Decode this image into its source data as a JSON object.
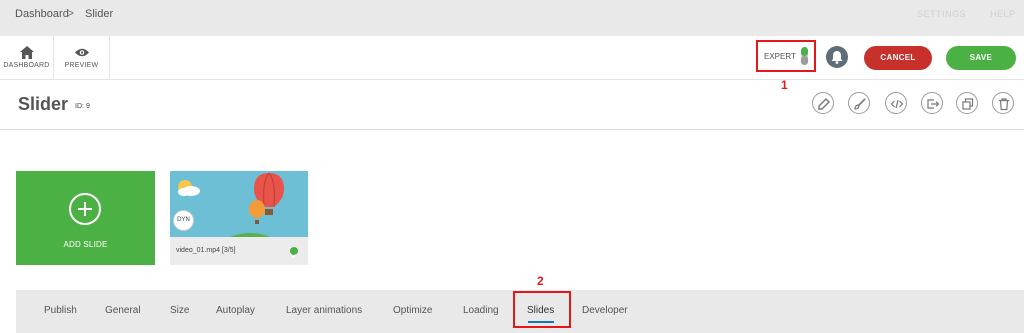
{
  "breadcrumb": {
    "items": [
      "Dashboard",
      "Slider"
    ],
    "separator": ">"
  },
  "top_links": [
    "SETTINGS",
    "HELP"
  ],
  "toolbar": {
    "dashboard_label": "DASHBOARD",
    "preview_label": "PREVIEW",
    "expert_label": "EXPERT",
    "expert_enabled": true,
    "cancel_label": "CANCEL",
    "save_label": "SAVE"
  },
  "annotations": [
    "1",
    "2"
  ],
  "header": {
    "title": "Slider",
    "id_label": "ID:",
    "id_value": "9",
    "actions": [
      "edit-icon",
      "brush-icon",
      "code-icon",
      "export-icon",
      "duplicate-icon",
      "trash-icon"
    ]
  },
  "slides": {
    "add_label": "ADD SLIDE",
    "items": [
      {
        "name": "video_01.mp4 [3/5]",
        "badge": "DYN",
        "published": true
      }
    ]
  },
  "tabs": [
    {
      "label": "Publish"
    },
    {
      "label": "General"
    },
    {
      "label": "Size"
    },
    {
      "label": "Autoplay"
    },
    {
      "label": "Layer animations"
    },
    {
      "label": "Optimize"
    },
    {
      "label": "Loading"
    },
    {
      "label": "Slides",
      "active": true
    },
    {
      "label": "Developer"
    }
  ],
  "colors": {
    "accent_green": "#4cb144",
    "cancel_red": "#c8302b",
    "annotation_red": "#e2181b",
    "tab_underline": "#1b75bc"
  }
}
